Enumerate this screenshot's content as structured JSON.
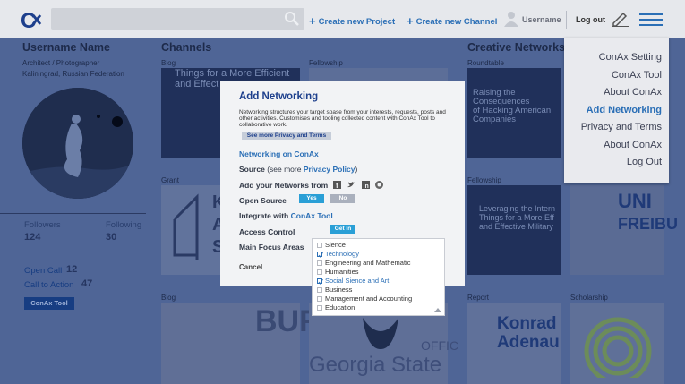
{
  "topbar": {
    "new_project": "Create new Project",
    "new_channel": "Create new Channel",
    "username": "Username",
    "logout": "Log out"
  },
  "profile": {
    "name": "Username Name",
    "role": "Architect / Photographer",
    "location": "Kaliningrad, Russian Federation",
    "followers_label": "Followers",
    "followers_value": "124",
    "following_label": "Following",
    "following_value": "30",
    "open_call_label": "Open Call",
    "open_call_value": "12",
    "call_to_action_label": "Call to Action",
    "call_to_action_value": "47",
    "tool_button": "ConAx Tool"
  },
  "channels": {
    "heading": "Channels",
    "cards": [
      {
        "label": "Blog",
        "text": "Things for a More Efficient\nand Effect..."
      },
      {
        "label": "Fellowship"
      },
      {
        "label": "Grant",
        "text": "K\nA\nS"
      },
      {
        "label": "Blog",
        "text": "BUR"
      },
      {
        "label": "",
        "text": "Georgia State | OFFICE INTE"
      }
    ]
  },
  "creative": {
    "heading": "Creative Networks",
    "cards": [
      {
        "label": "Roundtable",
        "text": "Raising the\nConsequences\nof Hacking American\nCompanies"
      },
      {
        "label": "Fellowship",
        "text": "Leveraging the Intern\nThings for a More Eff\nand Effective Military"
      },
      {
        "label": "Report",
        "text": "Konrad\nAdenau\nStiftun"
      },
      {
        "label": "Scholarship"
      }
    ]
  },
  "dropdown": {
    "items": [
      {
        "label": "ConAx Setting",
        "active": false
      },
      {
        "label": "ConAx Tool",
        "active": false
      },
      {
        "label": "About ConAx",
        "active": false
      },
      {
        "label": "Add Networking",
        "active": true
      },
      {
        "label": "Privacy and Terms",
        "active": false
      },
      {
        "label": "About ConAx",
        "active": false
      },
      {
        "label": "Log Out",
        "active": false
      }
    ]
  },
  "modal": {
    "title": "Add Networking",
    "description": "Networking structures your target spase from your interests, requests, posts and other activities. Customises and tooling collected content with ConAx Tool to collaborative work.",
    "privacy_button": "See more Privacy and Terms",
    "subtitle": "Networking on ConAx",
    "source_label": "Source",
    "source_see": "(see more",
    "source_link": "Privacy Policy",
    "source_end": ")",
    "networks_label": "Add your Networks from",
    "social_icons": [
      "facebook-icon",
      "twitter-icon",
      "linkedin-icon",
      "rss-icon"
    ],
    "open_source_label": "Open Source",
    "yes": "Yes",
    "no": "No",
    "integrate_label": "Integrate with",
    "integrate_link": "ConAx Tool",
    "access_label": "Access Control",
    "get_in": "Get In",
    "focus_label": "Main Focus Areas",
    "cancel": "Cancel",
    "focus_areas": [
      {
        "label": "Sience",
        "checked": false
      },
      {
        "label": "Technology",
        "checked": true
      },
      {
        "label": "Engineering and Mathematic",
        "checked": false
      },
      {
        "label": "Humanities",
        "checked": false
      },
      {
        "label": "Social Sience and Art",
        "checked": true
      },
      {
        "label": "Business",
        "checked": false
      },
      {
        "label": "Management and Accounting",
        "checked": false
      },
      {
        "label": "Education",
        "checked": false
      }
    ]
  },
  "colors": {
    "accent": "#2b6fb6",
    "dim_overlay": "#4f6596",
    "topbar": "#e6e8ec",
    "yes": "#2a9fd6",
    "no": "#aab0bd"
  }
}
